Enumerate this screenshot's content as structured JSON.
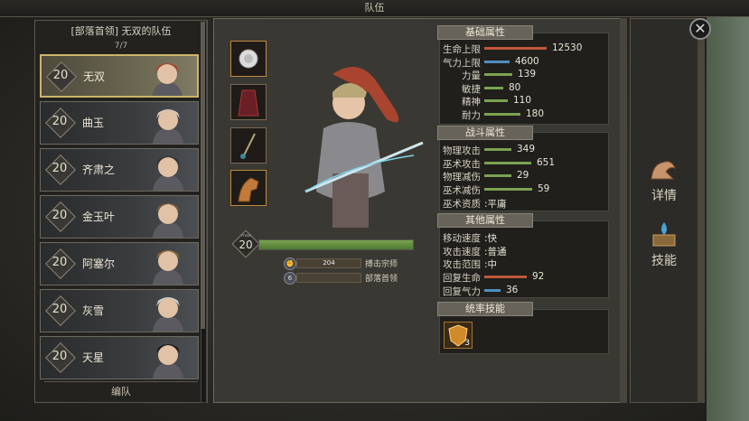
{
  "window": {
    "title": "队伍"
  },
  "roster": {
    "header": "[部落首领] 无双的队伍",
    "count": "7/7",
    "footer": "编队",
    "heroes": [
      {
        "level": "20",
        "name": "无双"
      },
      {
        "level": "20",
        "name": "曲玉"
      },
      {
        "level": "20",
        "name": "齐肃之"
      },
      {
        "level": "20",
        "name": "金玉叶"
      },
      {
        "level": "20",
        "name": "阿塞尔"
      },
      {
        "level": "20",
        "name": "灰雪"
      },
      {
        "level": "20",
        "name": "天星"
      }
    ]
  },
  "hero": {
    "level": "20",
    "level_max_tag": "max",
    "hp_fill": 1.0,
    "titles": [
      {
        "value": "204",
        "label": "搏击宗师",
        "icon": "fist-icon"
      },
      {
        "value": "6",
        "label": "部落首领",
        "icon": "rank-icon"
      }
    ]
  },
  "stats": {
    "basic_title": "基础属性",
    "basic": [
      {
        "label": "生命上限",
        "value": "12530",
        "color": "#c0583a",
        "fill": 0.95
      },
      {
        "label": "气力上限",
        "value": "4600",
        "color": "#4f8fbf",
        "fill": 0.35
      },
      {
        "label": "力量",
        "value": "139",
        "color": "#7aa352",
        "fill": 0.4
      },
      {
        "label": "敏捷",
        "value": "80",
        "color": "#7aa352",
        "fill": 0.25
      },
      {
        "label": "精神",
        "value": "110",
        "color": "#7aa352",
        "fill": 0.32
      },
      {
        "label": "耐力",
        "value": "180",
        "color": "#7aa352",
        "fill": 0.53
      }
    ],
    "combat_title": "战斗属性",
    "combat": [
      {
        "label": "物理攻击",
        "value": "349",
        "color": "#7aa352",
        "fill": 0.38
      },
      {
        "label": "巫术攻击",
        "value": "651",
        "color": "#7aa352",
        "fill": 0.7
      },
      {
        "label": "物理减伤",
        "value": "29",
        "color": "#7aa352",
        "fill": 0.38
      },
      {
        "label": "巫术减伤",
        "value": "59",
        "color": "#7aa352",
        "fill": 0.72
      }
    ],
    "combat_text": [
      {
        "label": "巫术资质",
        "value": ":平庸"
      }
    ],
    "other_title": "其他属性",
    "other_text": [
      {
        "label": "移动速度",
        "value": ":快"
      },
      {
        "label": "攻击速度",
        "value": ":普通"
      },
      {
        "label": "攻击范围",
        "value": ":中"
      }
    ],
    "other_bars": [
      {
        "label": "回复生命",
        "value": "92",
        "color": "#c0583a",
        "fill": 0.63
      },
      {
        "label": "回复气力",
        "value": "36",
        "color": "#4f8fbf",
        "fill": 0.2
      }
    ],
    "skill_title": "统率技能",
    "skill_count": "3"
  },
  "side": {
    "details_label": "详情",
    "skills_label": "技能",
    "close_icon": "close-icon"
  }
}
